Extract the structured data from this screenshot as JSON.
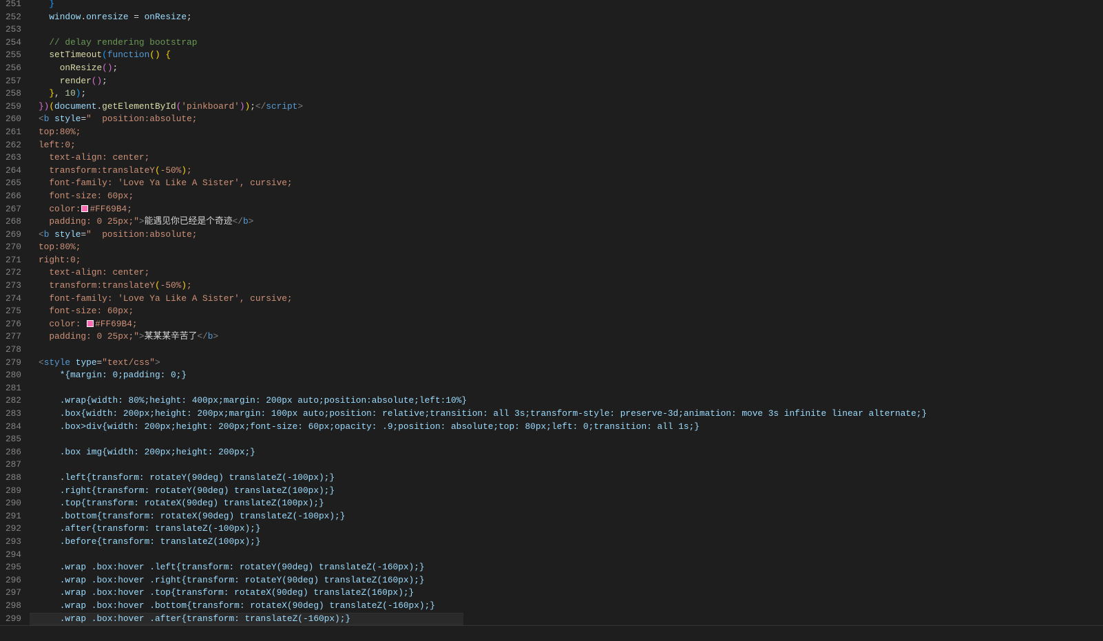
{
  "colors": {
    "background": "#1e1e1e",
    "swatch": "#FF69B4"
  },
  "current_line": 299,
  "lines": [
    {
      "n": "251",
      "tokens": [
        {
          "t": "  ",
          "c": ""
        },
        {
          "t": "}",
          "c": "b3"
        }
      ]
    },
    {
      "n": "252",
      "tokens": [
        {
          "t": "  ",
          "c": ""
        },
        {
          "t": "window",
          "c": "v"
        },
        {
          "t": ".",
          "c": ""
        },
        {
          "t": "onresize",
          "c": "v"
        },
        {
          "t": " = ",
          "c": ""
        },
        {
          "t": "onResize",
          "c": "v"
        },
        {
          "t": ";",
          "c": ""
        }
      ]
    },
    {
      "n": "253",
      "tokens": []
    },
    {
      "n": "254",
      "tokens": [
        {
          "t": "  ",
          "c": ""
        },
        {
          "t": "// delay rendering bootstrap",
          "c": "c"
        }
      ]
    },
    {
      "n": "255",
      "tokens": [
        {
          "t": "  ",
          "c": ""
        },
        {
          "t": "setTimeout",
          "c": "f"
        },
        {
          "t": "(",
          "c": "b3"
        },
        {
          "t": "function",
          "c": "k"
        },
        {
          "t": "()",
          "c": "b1"
        },
        {
          "t": " ",
          "c": ""
        },
        {
          "t": "{",
          "c": "b1"
        }
      ]
    },
    {
      "n": "256",
      "tokens": [
        {
          "t": "    ",
          "c": ""
        },
        {
          "t": "onResize",
          "c": "f"
        },
        {
          "t": "()",
          "c": "b2"
        },
        {
          "t": ";",
          "c": ""
        }
      ]
    },
    {
      "n": "257",
      "tokens": [
        {
          "t": "    ",
          "c": ""
        },
        {
          "t": "render",
          "c": "f"
        },
        {
          "t": "()",
          "c": "b2"
        },
        {
          "t": ";",
          "c": ""
        }
      ]
    },
    {
      "n": "258",
      "tokens": [
        {
          "t": "  ",
          "c": ""
        },
        {
          "t": "}",
          "c": "b1"
        },
        {
          "t": ", ",
          "c": ""
        },
        {
          "t": "10",
          "c": "n"
        },
        {
          "t": ")",
          "c": "b3"
        },
        {
          "t": ";",
          "c": ""
        }
      ]
    },
    {
      "n": "259",
      "tokens": [
        {
          "t": "})",
          "c": "b2"
        },
        {
          "t": "(",
          "c": "b1"
        },
        {
          "t": "document",
          "c": "v"
        },
        {
          "t": ".",
          "c": ""
        },
        {
          "t": "getElementById",
          "c": "f"
        },
        {
          "t": "(",
          "c": "b2"
        },
        {
          "t": "'pinkboard'",
          "c": "s"
        },
        {
          "t": ")",
          "c": "b2"
        },
        {
          "t": ")",
          "c": "b1"
        },
        {
          "t": ";",
          "c": ""
        },
        {
          "t": "</",
          "c": "t"
        },
        {
          "t": "script",
          "c": "tn"
        },
        {
          "t": ">",
          "c": "t"
        }
      ]
    },
    {
      "n": "260",
      "tokens": [
        {
          "t": "<",
          "c": "t"
        },
        {
          "t": "b",
          "c": "tn"
        },
        {
          "t": " ",
          "c": ""
        },
        {
          "t": "style",
          "c": "a"
        },
        {
          "t": "=",
          "c": ""
        },
        {
          "t": "\"  position:absolute;",
          "c": "s"
        }
      ]
    },
    {
      "n": "261",
      "tokens": [
        {
          "t": "top:80%;",
          "c": "s"
        }
      ]
    },
    {
      "n": "262",
      "tokens": [
        {
          "t": "left:0;",
          "c": "s"
        }
      ]
    },
    {
      "n": "263",
      "tokens": [
        {
          "t": "  text-align: center;",
          "c": "s"
        }
      ]
    },
    {
      "n": "264",
      "tokens": [
        {
          "t": "  transform:translateY",
          "c": "s"
        },
        {
          "t": "(",
          "c": "b1"
        },
        {
          "t": "-50%",
          "c": "s"
        },
        {
          "t": ")",
          "c": "b1"
        },
        {
          "t": ";",
          "c": "s"
        }
      ]
    },
    {
      "n": "265",
      "tokens": [
        {
          "t": "  font-family: 'Love Ya Like A Sister', cursive;",
          "c": "s"
        }
      ]
    },
    {
      "n": "266",
      "tokens": [
        {
          "t": "  font-size: 60px;",
          "c": "s"
        }
      ]
    },
    {
      "n": "267",
      "tokens": [
        {
          "t": "  color:",
          "c": "s"
        },
        {
          "t": "",
          "c": "swatch"
        },
        {
          "t": "#FF69B4;",
          "c": "s"
        }
      ]
    },
    {
      "n": "268",
      "tokens": [
        {
          "t": "  padding: 0 25px;\"",
          "c": "s"
        },
        {
          "t": ">",
          "c": "t"
        },
        {
          "t": "能遇见你已经是个奇迹",
          "c": ""
        },
        {
          "t": "</",
          "c": "t"
        },
        {
          "t": "b",
          "c": "tn"
        },
        {
          "t": ">",
          "c": "t"
        }
      ]
    },
    {
      "n": "269",
      "tokens": [
        {
          "t": "<",
          "c": "t"
        },
        {
          "t": "b",
          "c": "tn"
        },
        {
          "t": " ",
          "c": ""
        },
        {
          "t": "style",
          "c": "a"
        },
        {
          "t": "=",
          "c": ""
        },
        {
          "t": "\"  position:absolute;",
          "c": "s"
        }
      ]
    },
    {
      "n": "270",
      "tokens": [
        {
          "t": "top:80%;",
          "c": "s"
        }
      ]
    },
    {
      "n": "271",
      "tokens": [
        {
          "t": "right:0;",
          "c": "s"
        }
      ]
    },
    {
      "n": "272",
      "tokens": [
        {
          "t": "  text-align: center;",
          "c": "s"
        }
      ]
    },
    {
      "n": "273",
      "tokens": [
        {
          "t": "  transform:translateY",
          "c": "s"
        },
        {
          "t": "(",
          "c": "b1"
        },
        {
          "t": "-50%",
          "c": "s"
        },
        {
          "t": ")",
          "c": "b1"
        },
        {
          "t": ";",
          "c": "s"
        }
      ]
    },
    {
      "n": "274",
      "tokens": [
        {
          "t": "  font-family: 'Love Ya Like A Sister', cursive;",
          "c": "s"
        }
      ]
    },
    {
      "n": "275",
      "tokens": [
        {
          "t": "  font-size: 60px;",
          "c": "s"
        }
      ]
    },
    {
      "n": "276",
      "tokens": [
        {
          "t": "  color: ",
          "c": "s"
        },
        {
          "t": "",
          "c": "swatch"
        },
        {
          "t": "#FF69B4;",
          "c": "s"
        }
      ]
    },
    {
      "n": "277",
      "tokens": [
        {
          "t": "  padding: 0 25px;\"",
          "c": "s"
        },
        {
          "t": ">",
          "c": "t"
        },
        {
          "t": "某某某辛苦了",
          "c": ""
        },
        {
          "t": "</",
          "c": "t"
        },
        {
          "t": "b",
          "c": "tn"
        },
        {
          "t": ">",
          "c": "t"
        }
      ]
    },
    {
      "n": "278",
      "tokens": []
    },
    {
      "n": "279",
      "tokens": [
        {
          "t": "<",
          "c": "t"
        },
        {
          "t": "style",
          "c": "tn"
        },
        {
          "t": " ",
          "c": ""
        },
        {
          "t": "type",
          "c": "a"
        },
        {
          "t": "=",
          "c": ""
        },
        {
          "t": "\"text/css\"",
          "c": "s"
        },
        {
          "t": ">",
          "c": "t"
        }
      ]
    },
    {
      "n": "280",
      "css": "    *{margin: 0;padding: 0;}"
    },
    {
      "n": "281",
      "css": ""
    },
    {
      "n": "282",
      "css": "    .wrap{width: 80%;height: 400px;margin: 200px auto;position:absolute;left:10%}"
    },
    {
      "n": "283",
      "css": "    .box{width: 200px;height: 200px;margin: 100px auto;position: relative;transition: all 3s;transform-style: preserve-3d;animation: move 3s infinite linear alternate;}"
    },
    {
      "n": "284",
      "css": "    .box>div{width: 200px;height: 200px;font-size: 60px;opacity: .9;position: absolute;top: 80px;left: 0;transition: all 1s;}"
    },
    {
      "n": "285",
      "css": ""
    },
    {
      "n": "286",
      "css": "    .box img{width: 200px;height: 200px;}"
    },
    {
      "n": "287",
      "css": ""
    },
    {
      "n": "288",
      "css": "    .left{transform: rotateY(90deg) translateZ(-100px);}"
    },
    {
      "n": "289",
      "css": "    .right{transform: rotateY(90deg) translateZ(100px);}"
    },
    {
      "n": "290",
      "css": "    .top{transform: rotateX(90deg) translateZ(100px);}"
    },
    {
      "n": "291",
      "css": "    .bottom{transform: rotateX(90deg) translateZ(-100px);}"
    },
    {
      "n": "292",
      "css": "    .after{transform: translateZ(-100px);}"
    },
    {
      "n": "293",
      "css": "    .before{transform: translateZ(100px);}"
    },
    {
      "n": "294",
      "css": ""
    },
    {
      "n": "295",
      "css": "    .wrap .box:hover .left{transform: rotateY(90deg) translateZ(-160px);}"
    },
    {
      "n": "296",
      "css": "    .wrap .box:hover .right{transform: rotateY(90deg) translateZ(160px);}"
    },
    {
      "n": "297",
      "css": "    .wrap .box:hover .top{transform: rotateX(90deg) translateZ(160px);}"
    },
    {
      "n": "298",
      "css": "    .wrap .box:hover .bottom{transform: rotateX(90deg) translateZ(-160px);}"
    },
    {
      "n": "299",
      "css": "    .wrap .box:hover .after{transform: translateZ(-160px);}"
    }
  ]
}
